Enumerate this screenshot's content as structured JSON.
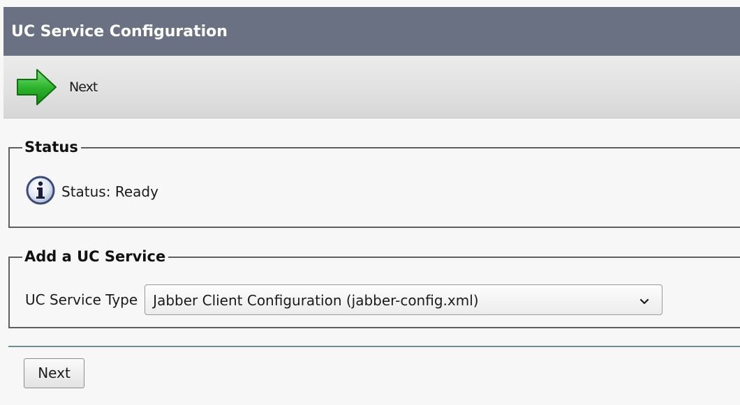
{
  "header": {
    "title": "UC Service Configuration"
  },
  "toolbar": {
    "next_label": "Next",
    "next_icon": "arrow-right-icon",
    "next_icon_color": "#2fb52f"
  },
  "status_section": {
    "legend": "Status",
    "icon": "info-icon",
    "text": "Status: Ready"
  },
  "service_section": {
    "legend": "Add a UC Service",
    "field_label": "UC Service Type",
    "selected_value": "Jabber Client Configuration (jabber-config.xml)"
  },
  "footer": {
    "next_label": "Next"
  },
  "colors": {
    "title_bar": "#6a7182",
    "divider": "#6e8f90"
  }
}
